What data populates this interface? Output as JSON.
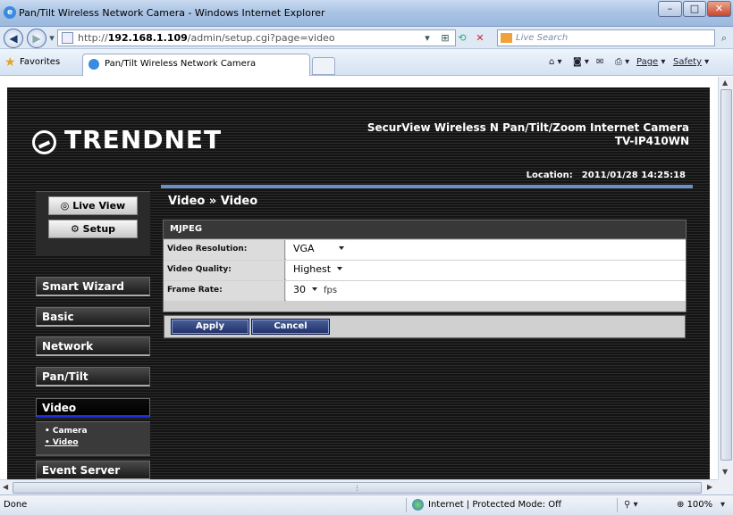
{
  "browser": {
    "window_title": "Pan/Tilt Wireless Network Camera - Windows Internet Explorer",
    "url_prefix": "http://",
    "url_host": "192.168.1.109",
    "url_path": "/admin/setup.cgi?page=video",
    "search_placeholder": "Live Search",
    "favorites_label": "Favorites",
    "tab_title": "Pan/Tilt Wireless Network Camera",
    "cmd_page": "Page",
    "cmd_safety": "Safety",
    "status_text": "Done",
    "zone_text": "Internet | Protected Mode: Off",
    "zoom_text": "100%"
  },
  "camera": {
    "brand": "TRENDNET",
    "product_line1": "SecurView Wireless N Pan/Tilt/Zoom Internet Camera",
    "product_line2": "TV-IP410WN",
    "location_label": "Location:",
    "datetime": "2011/01/28 14:25:18"
  },
  "sidebar": {
    "live_view": "Live View",
    "setup": "Setup",
    "menu": [
      "Smart Wizard",
      "Basic",
      "Network",
      "Pan/Tilt",
      "Video",
      "Event Server"
    ],
    "submenu": [
      "• Camera",
      "• Video"
    ]
  },
  "content": {
    "title": "Video » Video",
    "section": "MJPEG",
    "rows": [
      {
        "label": "Video Resolution:",
        "value": "VGA",
        "unit": ""
      },
      {
        "label": "Video Quality:",
        "value": "Highest",
        "unit": ""
      },
      {
        "label": "Frame Rate:",
        "value": "30",
        "unit": "fps"
      }
    ],
    "apply": "Apply",
    "cancel": "Cancel"
  },
  "colors": {
    "accent_bar": "#6c8fc4",
    "active_menu_underline": "#1a2fd8",
    "button_blue": "#2a3b7a"
  }
}
